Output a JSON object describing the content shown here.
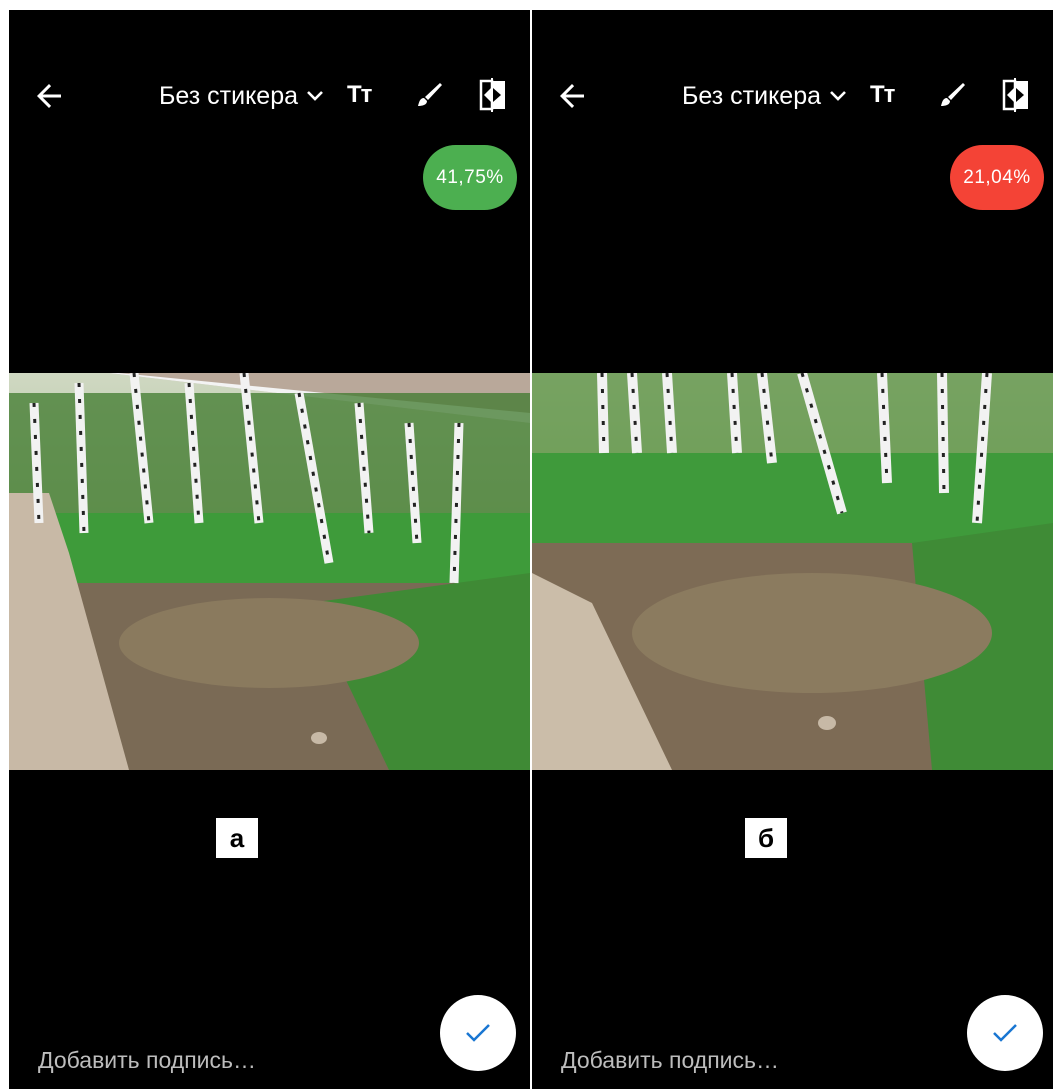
{
  "panels": [
    {
      "id": "a",
      "sticker_label": "Без стикера",
      "text_icon_label": "Tт",
      "score": "41,75%",
      "score_color": "#4CAF50",
      "marker": "а",
      "caption_placeholder": "Добавить подпись…"
    },
    {
      "id": "b",
      "sticker_label": "Без стикера",
      "text_icon_label": "Tт",
      "score": "21,04%",
      "score_color": "#F44336",
      "marker": "б",
      "caption_placeholder": "Добавить подпись…"
    }
  ],
  "icons": [
    "back-arrow-icon",
    "chevron-down-icon",
    "text-icon",
    "brush-icon",
    "compare-icon",
    "check-icon"
  ],
  "colors": {
    "background": "#000000",
    "accent_check": "#1976D2",
    "positive": "#4CAF50",
    "negative": "#F44336"
  }
}
